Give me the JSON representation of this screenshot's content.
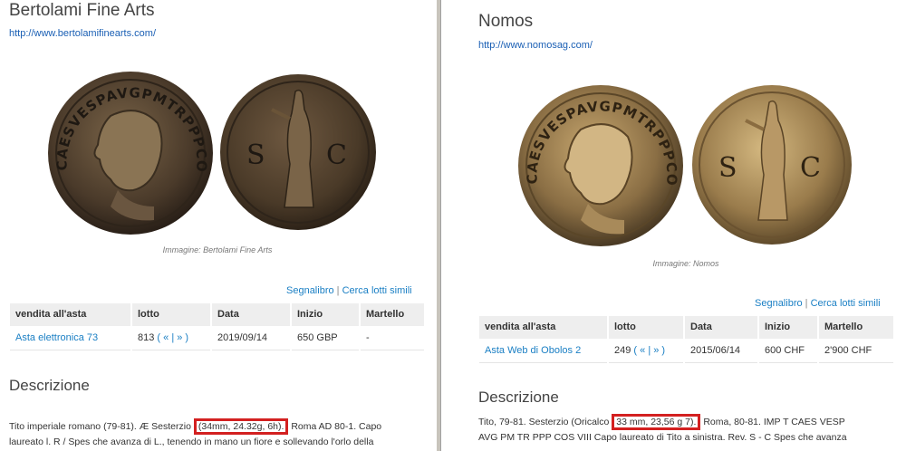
{
  "left": {
    "house_name": "Bertolami Fine Arts",
    "house_url": "http://www.bertolamifinearts.com/",
    "coin_obverse_legend": "CAESVESPAVGPMTRPPPCOSVIII",
    "coin_reverse_letters": [
      "S",
      "C"
    ],
    "image_caption": "Immagine: Bertolami Fine Arts",
    "bookmark_label": "Segnalibro",
    "separator": "|",
    "similar_label": "Cerca lotti simili",
    "table": {
      "headers": [
        "vendita all'asta",
        "lotto",
        "Data",
        "Inizio",
        "Martello"
      ],
      "row": {
        "sale": "Asta elettronica 73",
        "lot_number": "813",
        "lot_nav": "( « | » )",
        "date": "2019/09/14",
        "start": "650 GBP",
        "hammer": "-"
      }
    },
    "description_title": "Descrizione",
    "description_line1_before": "Tito imperiale romano (79-81). Æ Sesterzio",
    "description_line1_highlight": "(34mm, 24.32g, 6h).",
    "description_line1_after": "Roma AD 80-1. Capo",
    "description_line2": "laureato l. R / Spes che avanza di L., tenendo in mano un fiore e sollevando l'orlo della"
  },
  "right": {
    "house_name": "Nomos",
    "house_url": "http://www.nomosag.com/",
    "coin_obverse_legend": "CAESVESPAVGPMTRPPPCOSVIII",
    "coin_reverse_letters": [
      "S",
      "C"
    ],
    "image_caption": "Immagine: Nomos",
    "bookmark_label": "Segnalibro",
    "separator": "|",
    "similar_label": "Cerca lotti simili",
    "table": {
      "headers": [
        "vendita all'asta",
        "lotto",
        "Data",
        "Inizio",
        "Martello"
      ],
      "row": {
        "sale": "Asta Web di Obolos 2",
        "lot_number": "249",
        "lot_nav": "( « | » )",
        "date": "2015/06/14",
        "start": "600 CHF",
        "hammer": "2'900 CHF"
      }
    },
    "description_title": "Descrizione",
    "description_line1_before": "Tito, 79-81. Sesterzio (Oricalco",
    "description_line1_highlight": "33 mm, 23,56 g 7).",
    "description_line1_after": "Roma, 80-81. IMP T CAES VESP",
    "description_line2": "AVG PM TR PPP COS VIII Capo laureato di Tito a sinistra. Rev. S - C Spes che avanza"
  },
  "colors": {
    "link": "#1a7fc4",
    "highlight_border": "#d32020",
    "table_header_bg": "#eeeeee"
  }
}
